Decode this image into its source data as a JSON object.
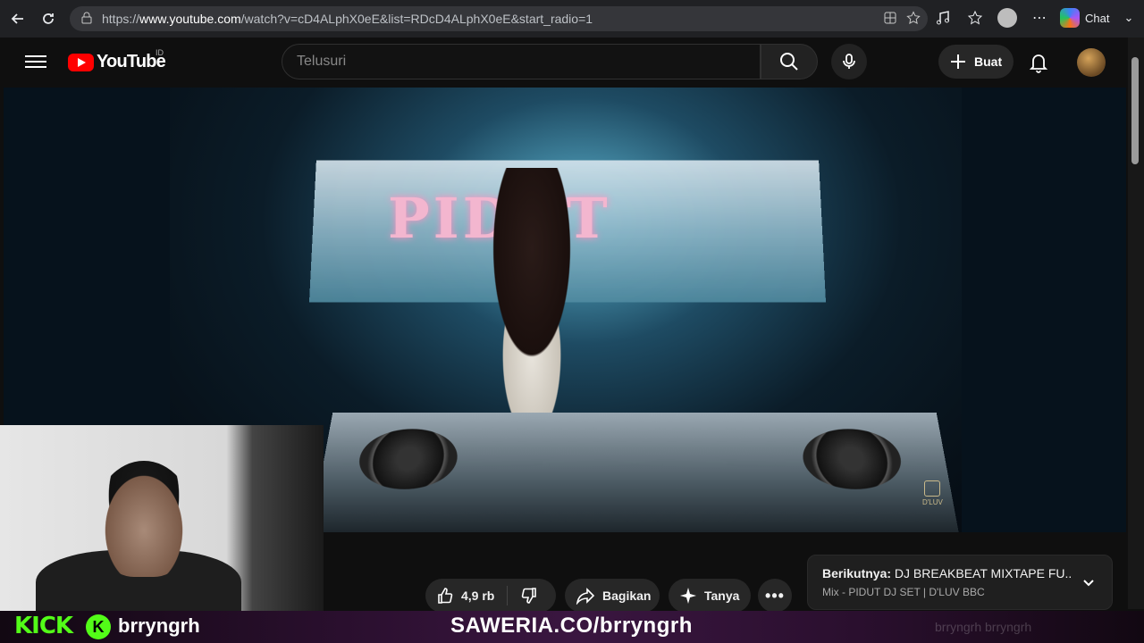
{
  "browser": {
    "url_prefix": "https://",
    "url_domain": "www.youtube.com",
    "url_path": "/watch?v=cD4ALphX0eE&list=RDcD4ALphX0eE&start_radio=1",
    "chat_label": "Chat"
  },
  "header": {
    "logo_text": "YouTube",
    "region": "ID",
    "search_placeholder": "Telusuri",
    "create_label": "Buat"
  },
  "video": {
    "stage_title": "PIDUT",
    "watermark": "D'LUV"
  },
  "actions": {
    "like_count": "4,9 rb",
    "share_label": "Bagikan",
    "ask_label": "Tanya",
    "more_label": "•••"
  },
  "up_next": {
    "prefix": "Berikutnya:",
    "title": " DJ BREAKBEAT MIXTAPE FU...",
    "subtitle": "Mix - PIDUT DJ SET | D'LUV BBC"
  },
  "overlay": {
    "kick_label": "KICK",
    "kick_user": "brryngrh",
    "saweria": "SAWERIA.CO/brryngrh",
    "social_ghost": "brryngrh     brryngrh"
  },
  "colors": {
    "brand_red": "#ff0000",
    "kick_green": "#53fc18",
    "background": "#0f0f0f"
  }
}
